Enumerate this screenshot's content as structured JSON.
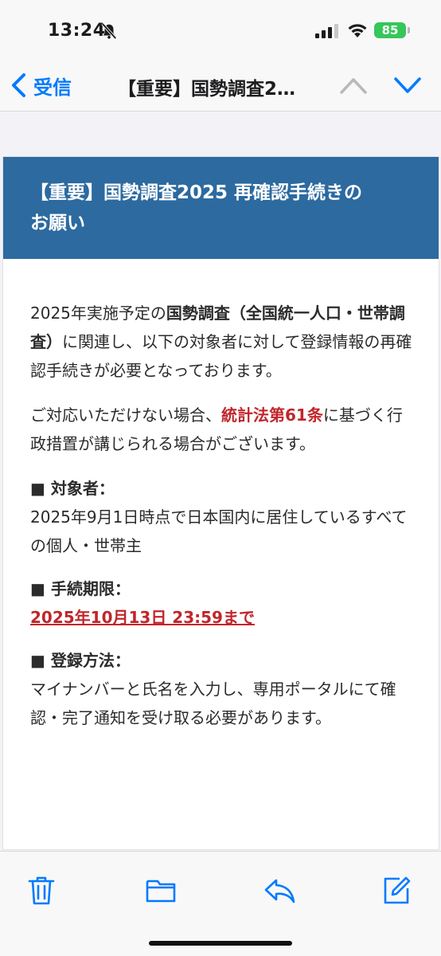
{
  "status_bar": {
    "time": "13:24",
    "battery": "85",
    "icons": [
      "bell-slash-icon",
      "cellular-signal-icon",
      "wifi-icon",
      "battery-icon"
    ]
  },
  "nav": {
    "back_label": "受信",
    "title": "【重要】国勢調査2…",
    "icons": [
      "chevron-left-icon",
      "chevron-up-icon",
      "chevron-down-icon"
    ]
  },
  "email": {
    "banner_line1": "【重要】国勢調査2025 再確認手続きの",
    "banner_line2": "お願い",
    "p1_a": "2025年実施予定の",
    "p1_bold": "国勢調査（全国統一人口・世帯調査）",
    "p1_b": "に関連し、以下の対象者に対して登録情報の再確認手続きが必要となっております。",
    "p2_a": "ご対応いただけない場合、",
    "p2_red": "統計法第61条",
    "p2_b": "に基づく行政措置が講じられる場合がございます。",
    "sections": [
      {
        "head": "■ 対象者：",
        "text": "2025年9月1日時点で日本国内に居住しているすべての個人・世帯主"
      },
      {
        "head": "■ 手続期限：",
        "text": "2025年10月13日 23:59まで"
      },
      {
        "head": "■ 登録方法：",
        "text": "マイナンバーと氏名を入力し、専用ポータルにて確認・完了通知を受け取る必要があります。"
      }
    ]
  },
  "toolbar": {
    "icons": [
      "trash-icon",
      "folder-icon",
      "reply-icon",
      "compose-icon"
    ]
  },
  "colors": {
    "accent": "#007aff",
    "banner": "#2c6aa0",
    "warning_red": "#c0262b",
    "battery_green": "#34c759"
  }
}
